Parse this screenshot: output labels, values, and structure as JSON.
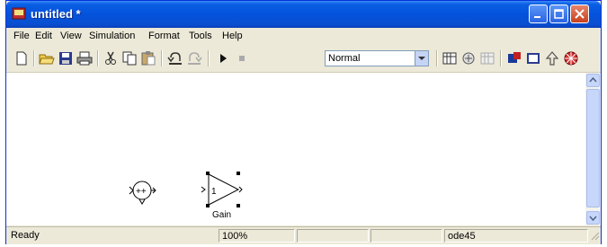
{
  "window": {
    "title": "untitled *"
  },
  "menu": [
    "File",
    "Edit",
    "View",
    "Simulation",
    "Format",
    "Tools",
    "Help"
  ],
  "toolbar": {
    "sim_mode": "Normal",
    "icons": [
      "new-icon",
      "open-icon",
      "save-icon",
      "print-icon",
      "cut-icon",
      "copy-icon",
      "paste-icon",
      "undo-icon",
      "redo-icon",
      "start-simulation-icon",
      "stop-simulation-icon",
      "build-icon",
      "update-diagram-icon",
      "library-browser-icon",
      "model-explorer-icon",
      "parent-icon",
      "debug-icon"
    ]
  },
  "blocks": {
    "sum": {
      "signs": "++"
    },
    "gain": {
      "value": "1",
      "label": "Gain"
    }
  },
  "status": {
    "left": "Ready",
    "zoom": "100%",
    "solver": "ode45"
  }
}
